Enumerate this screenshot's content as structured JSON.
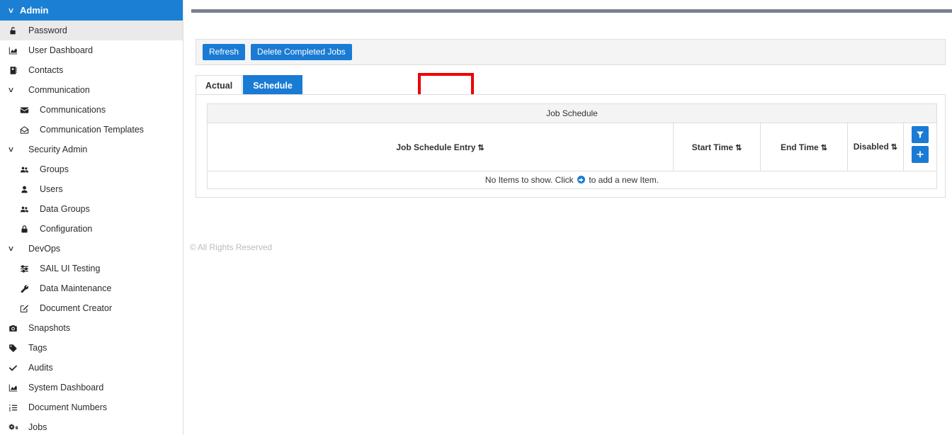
{
  "sidebar": {
    "header": {
      "label": "Admin",
      "icon": "chevron-down-icon"
    },
    "items": [
      {
        "label": "Password",
        "icon": "unlock-icon",
        "level": "group",
        "selected": true
      },
      {
        "label": "User Dashboard",
        "icon": "chart-area-icon",
        "level": "group",
        "selected": false
      },
      {
        "label": "Contacts",
        "icon": "address-book-icon",
        "level": "group",
        "selected": false
      },
      {
        "label": "Communication",
        "icon": "chevron-down-icon",
        "level": "group",
        "selected": false
      },
      {
        "label": "Communications",
        "icon": "envelope-icon",
        "level": "child",
        "selected": false
      },
      {
        "label": "Communication Templates",
        "icon": "envelope-open-icon",
        "level": "child",
        "selected": false
      },
      {
        "label": "Security Admin",
        "icon": "chevron-down-icon",
        "level": "group",
        "selected": false
      },
      {
        "label": "Groups",
        "icon": "users-icon",
        "level": "child",
        "selected": false
      },
      {
        "label": "Users",
        "icon": "user-icon",
        "level": "child",
        "selected": false
      },
      {
        "label": "Data Groups",
        "icon": "users-icon",
        "level": "child",
        "selected": false
      },
      {
        "label": "Configuration",
        "icon": "lock-icon",
        "level": "child",
        "selected": false
      },
      {
        "label": "DevOps",
        "icon": "chevron-down-icon",
        "level": "group",
        "selected": false
      },
      {
        "label": "SAIL UI Testing",
        "icon": "sliders-icon",
        "level": "child",
        "selected": false
      },
      {
        "label": "Data Maintenance",
        "icon": "wrench-icon",
        "level": "child",
        "selected": false
      },
      {
        "label": "Document Creator",
        "icon": "edit-icon",
        "level": "child",
        "selected": false
      },
      {
        "label": "Snapshots",
        "icon": "camera-icon",
        "level": "group",
        "selected": false
      },
      {
        "label": "Tags",
        "icon": "tag-icon",
        "level": "group",
        "selected": false
      },
      {
        "label": "Audits",
        "icon": "check-icon",
        "level": "group",
        "selected": false
      },
      {
        "label": "System Dashboard",
        "icon": "chart-area-icon",
        "level": "group",
        "selected": false
      },
      {
        "label": "Document Numbers",
        "icon": "list-ol-icon",
        "level": "group",
        "selected": false
      },
      {
        "label": "Jobs",
        "icon": "cogs-icon",
        "level": "group",
        "selected": false
      }
    ]
  },
  "toolbar": {
    "refresh_label": "Refresh",
    "delete_completed_label": "Delete Completed Jobs"
  },
  "tabs": [
    {
      "label": "Actual",
      "active": false
    },
    {
      "label": "Schedule",
      "active": true
    }
  ],
  "grid": {
    "title": "Job Schedule",
    "columns": [
      {
        "label": "Job Schedule Entry",
        "sortable": true
      },
      {
        "label": "Start Time",
        "sortable": true
      },
      {
        "label": "End Time",
        "sortable": true
      },
      {
        "label": "Disabled",
        "sortable": true
      }
    ],
    "sort_glyph": "⇅",
    "actions": [
      {
        "name": "filter-button",
        "icon": "filter-icon"
      },
      {
        "name": "add-button",
        "icon": "plus-icon"
      }
    ],
    "empty_message_before": "No Items to show. Click",
    "empty_message_after": "to add a new Item.",
    "rows": []
  },
  "footer": {
    "copyright_symbol": "©",
    "text": "All Rights Reserved"
  },
  "colors": {
    "accent_blue": "#1a7bd4",
    "header_blue": "#1b80d4",
    "highlight_red": "#ee0000",
    "rule_gray": "#78828c",
    "panel_gray": "#f4f4f4",
    "selected_gray": "#eaeaea",
    "footer_gray": "#b9bcc0"
  }
}
